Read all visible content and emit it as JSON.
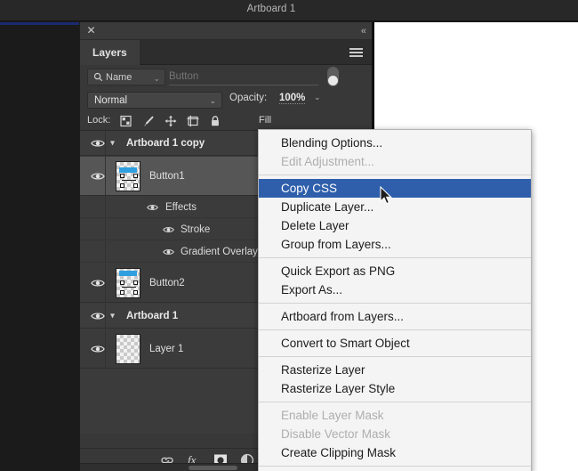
{
  "document": {
    "title": "Artboard 1"
  },
  "panel": {
    "close_label": "✕",
    "collapse_label": "«",
    "tab_label": "Layers",
    "menu_icon": "hamburger-menu-icon",
    "filter": {
      "kind_label": "Name",
      "kind_icon": "search-icon",
      "caret": "⌄",
      "input_value": "",
      "input_placeholder": "Button",
      "toggle_state": "off"
    },
    "blend": {
      "mode": "Normal",
      "caret": "⌄",
      "opacity_label": "Opacity:",
      "opacity_value": "100%",
      "opacity_caret": "⌄"
    },
    "lock": {
      "label": "Lock:",
      "icons": [
        "transparent-pixels-icon",
        "brush-icon",
        "move-icon",
        "artboard-nesting-icon",
        "lock-all-icon"
      ],
      "fill_label": "Fill"
    },
    "layers": [
      {
        "name": "Artboard 1 copy",
        "type": "group",
        "expanded": true,
        "visible": true
      },
      {
        "name": "Button1",
        "type": "layer",
        "selected": true,
        "visible": true,
        "thumb": "button-blue"
      },
      {
        "name": "Effects",
        "type": "effects",
        "visible": true
      },
      {
        "name": "Stroke",
        "type": "effect",
        "visible": true
      },
      {
        "name": "Gradient Overlay",
        "type": "effect",
        "visible": true
      },
      {
        "name": "Button2",
        "type": "layer",
        "selected": false,
        "visible": true,
        "thumb": "button-blue"
      },
      {
        "name": "Artboard 1",
        "type": "group",
        "expanded": true,
        "visible": true
      },
      {
        "name": "Layer 1",
        "type": "layer",
        "selected": false,
        "visible": true,
        "thumb": "empty"
      }
    ],
    "footer_icons": [
      "link-layers-icon",
      "layer-style-fx-icon",
      "add-layer-mask-icon",
      "new-fill-adjustment-icon"
    ]
  },
  "context_menu": {
    "items": [
      {
        "label": "Blending Options...",
        "state": "normal"
      },
      {
        "label": "Edit Adjustment...",
        "state": "disabled"
      },
      {
        "label": "separator",
        "state": "separator"
      },
      {
        "label": "Copy CSS",
        "state": "highlighted"
      },
      {
        "label": "Duplicate Layer...",
        "state": "normal"
      },
      {
        "label": "Delete Layer",
        "state": "normal"
      },
      {
        "label": "Group from Layers...",
        "state": "normal"
      },
      {
        "label": "separator",
        "state": "separator"
      },
      {
        "label": "Quick Export as PNG",
        "state": "normal"
      },
      {
        "label": "Export As...",
        "state": "normal"
      },
      {
        "label": "separator",
        "state": "separator"
      },
      {
        "label": "Artboard from Layers...",
        "state": "normal"
      },
      {
        "label": "separator",
        "state": "separator"
      },
      {
        "label": "Convert to Smart Object",
        "state": "normal"
      },
      {
        "label": "separator",
        "state": "separator"
      },
      {
        "label": "Rasterize Layer",
        "state": "normal"
      },
      {
        "label": "Rasterize Layer Style",
        "state": "normal"
      },
      {
        "label": "separator",
        "state": "separator"
      },
      {
        "label": "Enable Layer Mask",
        "state": "disabled"
      },
      {
        "label": "Disable Vector Mask",
        "state": "disabled"
      },
      {
        "label": "Create Clipping Mask",
        "state": "normal"
      },
      {
        "label": "separator",
        "state": "separator"
      }
    ],
    "highlight_color": "#2f5fab"
  },
  "colors": {
    "panel_bg": "#383838",
    "list_bg": "#3b3b3b",
    "selected_row": "#565656",
    "menu_bg": "#f4f4f4",
    "accent_blue": "#2f5fab",
    "rule_blue": "#1b2a72",
    "thumb_blue": "#2f9fe0"
  }
}
